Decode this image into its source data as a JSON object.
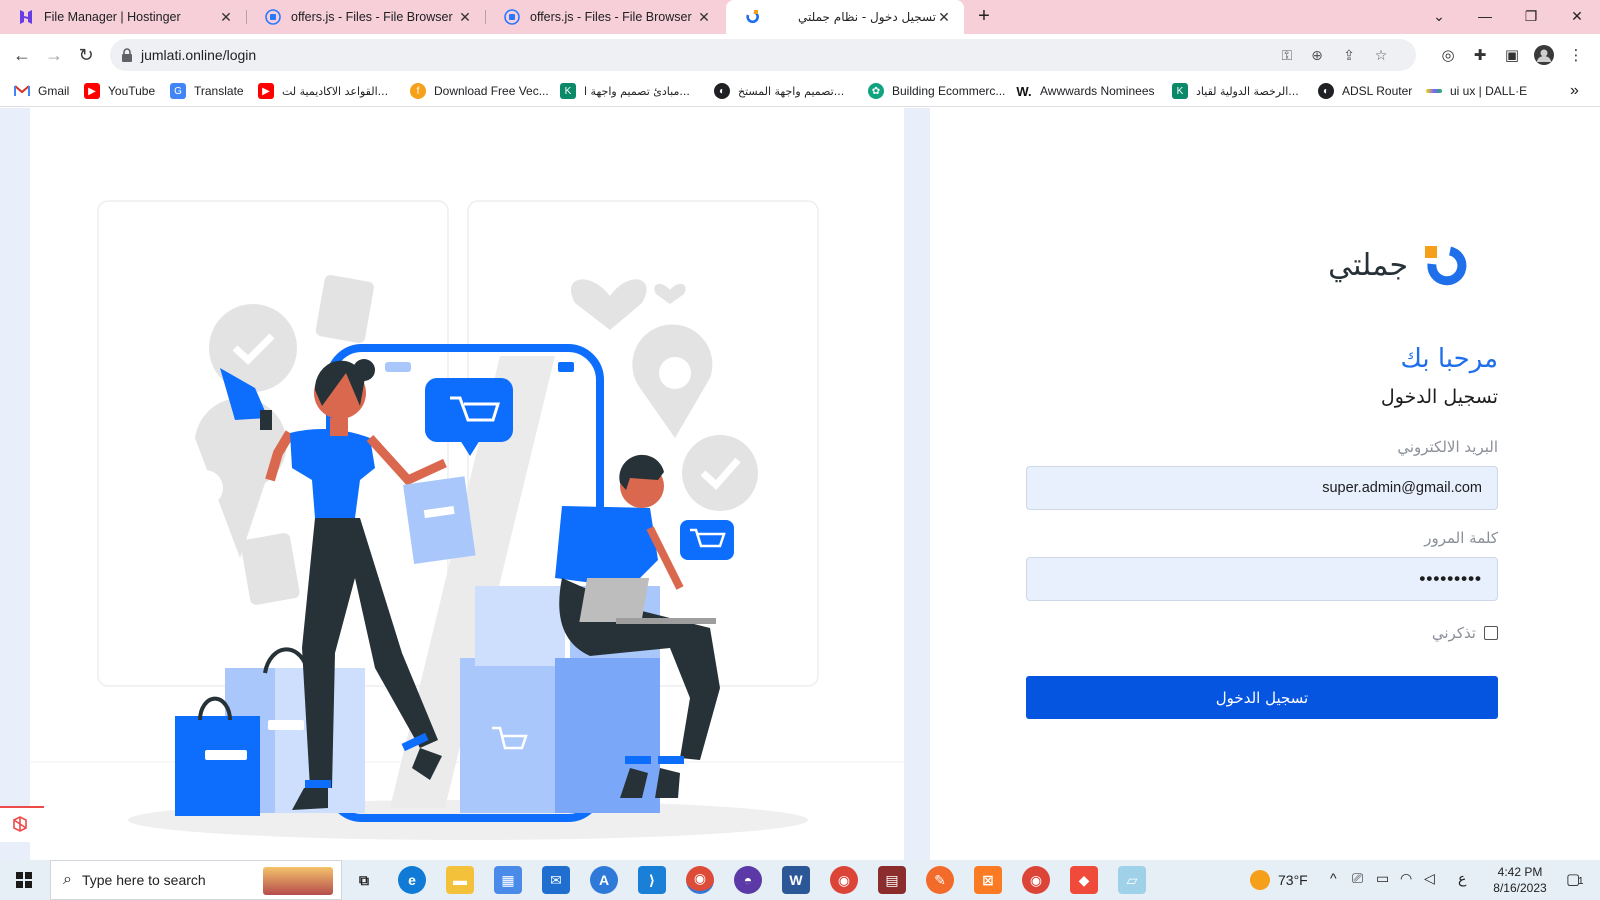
{
  "browser": {
    "tabs": [
      {
        "title": "File Manager | Hostinger",
        "favicon": "hostinger-icon",
        "active": false
      },
      {
        "title": "offers.js - Files - File Browser",
        "favicon": "filebrowser-icon",
        "active": false
      },
      {
        "title": "offers.js - Files - File Browser",
        "favicon": "filebrowser-icon",
        "active": false
      },
      {
        "title": "تسجيل دخول - نظام جملتي",
        "favicon": "jumlati-icon",
        "active": true
      }
    ],
    "new_tab": "+",
    "url": "jumlati.online/login",
    "bookmarks": [
      {
        "label": "Gmail",
        "icon": "gmail-icon",
        "color": "#d93025"
      },
      {
        "label": "YouTube",
        "icon": "youtube-icon",
        "color": "#ff0000"
      },
      {
        "label": "Translate",
        "icon": "translate-icon",
        "color": "#4285f4"
      },
      {
        "label": "القواعد الاكاديمية لت...",
        "icon": "youtube-icon",
        "color": "#ff0000"
      },
      {
        "label": "Download Free Vec...",
        "icon": "freepik-icon",
        "color": "#f7a11a"
      },
      {
        "label": "مبادئ تصميم واجهة ا...",
        "icon": "k-icon",
        "color": "#0b8a6a"
      },
      {
        "label": "تصميم واجهة المستخ...",
        "icon": "globe-icon",
        "color": "#202124"
      },
      {
        "label": "Building Ecommerc...",
        "icon": "chatgpt-icon",
        "color": "#10a37f"
      },
      {
        "label": "Awwwards Nominees",
        "icon": "w-icon",
        "color": "#111111"
      },
      {
        "label": "الرخصة الدولية لقياد...",
        "icon": "k-icon",
        "color": "#0b8a6a"
      },
      {
        "label": "ADSL Router",
        "icon": "globe-icon",
        "color": "#202124"
      },
      {
        "label": "ui ux | DALL·E",
        "icon": "dalle-icon",
        "color": "#7b61ff"
      }
    ],
    "more_bookmarks": "»"
  },
  "login": {
    "brand": "جملتي",
    "welcome": "مرحبا بك",
    "subtitle": "تسجيل الدخول",
    "email_label": "البريد الالكتروني",
    "email_value": "super.admin@gmail.com",
    "password_label": "كلمة المرور",
    "password_value": "•••••••••",
    "remember_label": "تذكرني",
    "remember_checked": false,
    "submit_label": "تسجيل الدخول",
    "accent": "#0655e0",
    "brand_blue": "#1f6feb",
    "brand_orange": "#f59f1b"
  },
  "taskbar": {
    "search_placeholder": "Type here to search",
    "weather": "73°F",
    "lang": "ع",
    "time": "4:42 PM",
    "date": "8/16/2023",
    "notifications": "1"
  }
}
